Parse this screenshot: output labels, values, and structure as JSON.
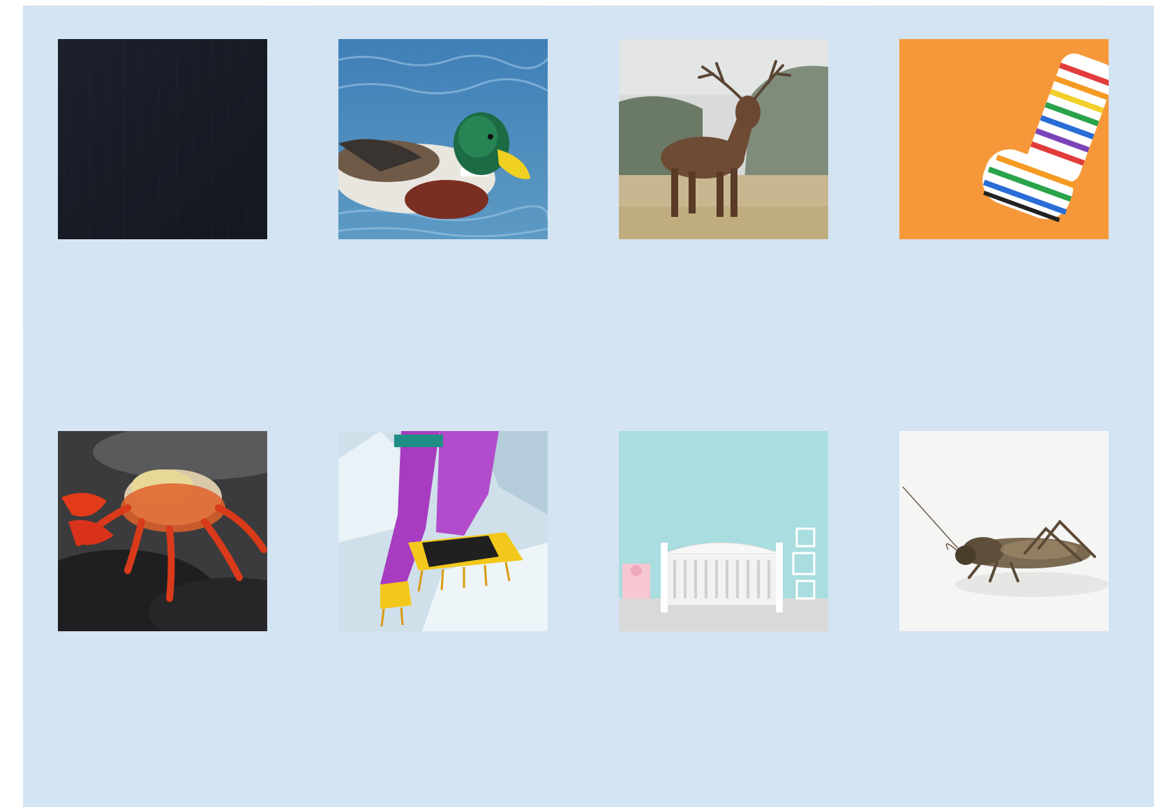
{
  "grid": {
    "background": "#d3e4f3",
    "tiles": [
      {
        "icon": "black-fabric-image"
      },
      {
        "icon": "mallard-duck-image"
      },
      {
        "icon": "red-deer-stag-image"
      },
      {
        "icon": "striped-sock-image"
      },
      {
        "icon": "red-crab-image"
      },
      {
        "icon": "crampon-boots-image"
      },
      {
        "icon": "baby-crib-image"
      },
      {
        "icon": "cricket-insect-image"
      }
    ]
  }
}
